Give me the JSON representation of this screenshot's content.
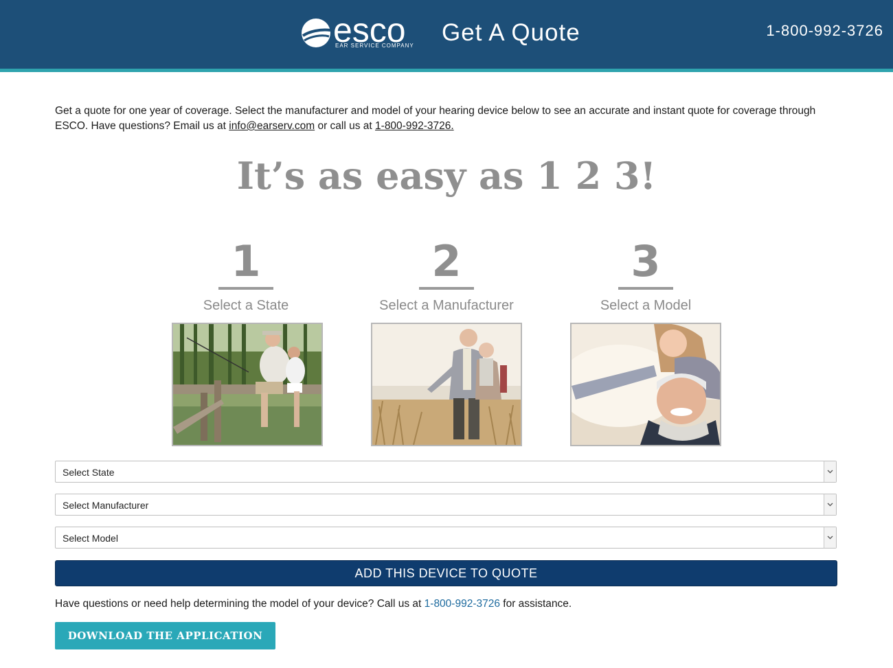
{
  "header": {
    "logo_word": "esco",
    "logo_sub": "EAR SERVICE COMPANY",
    "title": "Get A Quote",
    "phone": "1-800-992-3726"
  },
  "intro": {
    "text_1": "Get a quote for one year of coverage. Select the manufacturer and model of your hearing device below to see an accurate and instant quote for coverage through ESCO. Have questions? Email us at ",
    "email": "info@earserv.com",
    "text_2": " or call us at ",
    "phone": "1-800-992-3726."
  },
  "headline": "It’s as easy as 1 2 3!",
  "steps": [
    {
      "number": "1",
      "label": "Select a State"
    },
    {
      "number": "2",
      "label": "Select a Manufacturer"
    },
    {
      "number": "3",
      "label": "Select a Model"
    }
  ],
  "selects": {
    "state": "Select State",
    "manufacturer": "Select Manufacturer",
    "model": "Select Model"
  },
  "add_button": "ADD THIS DEVICE TO QUOTE",
  "help": {
    "text_1": "Have questions or need help determining the model of your device? Call us at ",
    "phone": "1-800-992-3726",
    "text_2": " for assistance."
  },
  "download_button": "DOWNLOAD THE APPLICATION",
  "colors": {
    "header_bg": "#1d4f78",
    "header_stripe": "#2fa3ae",
    "add_button": "#0f3c6e",
    "download_button": "#2aa8b8"
  }
}
